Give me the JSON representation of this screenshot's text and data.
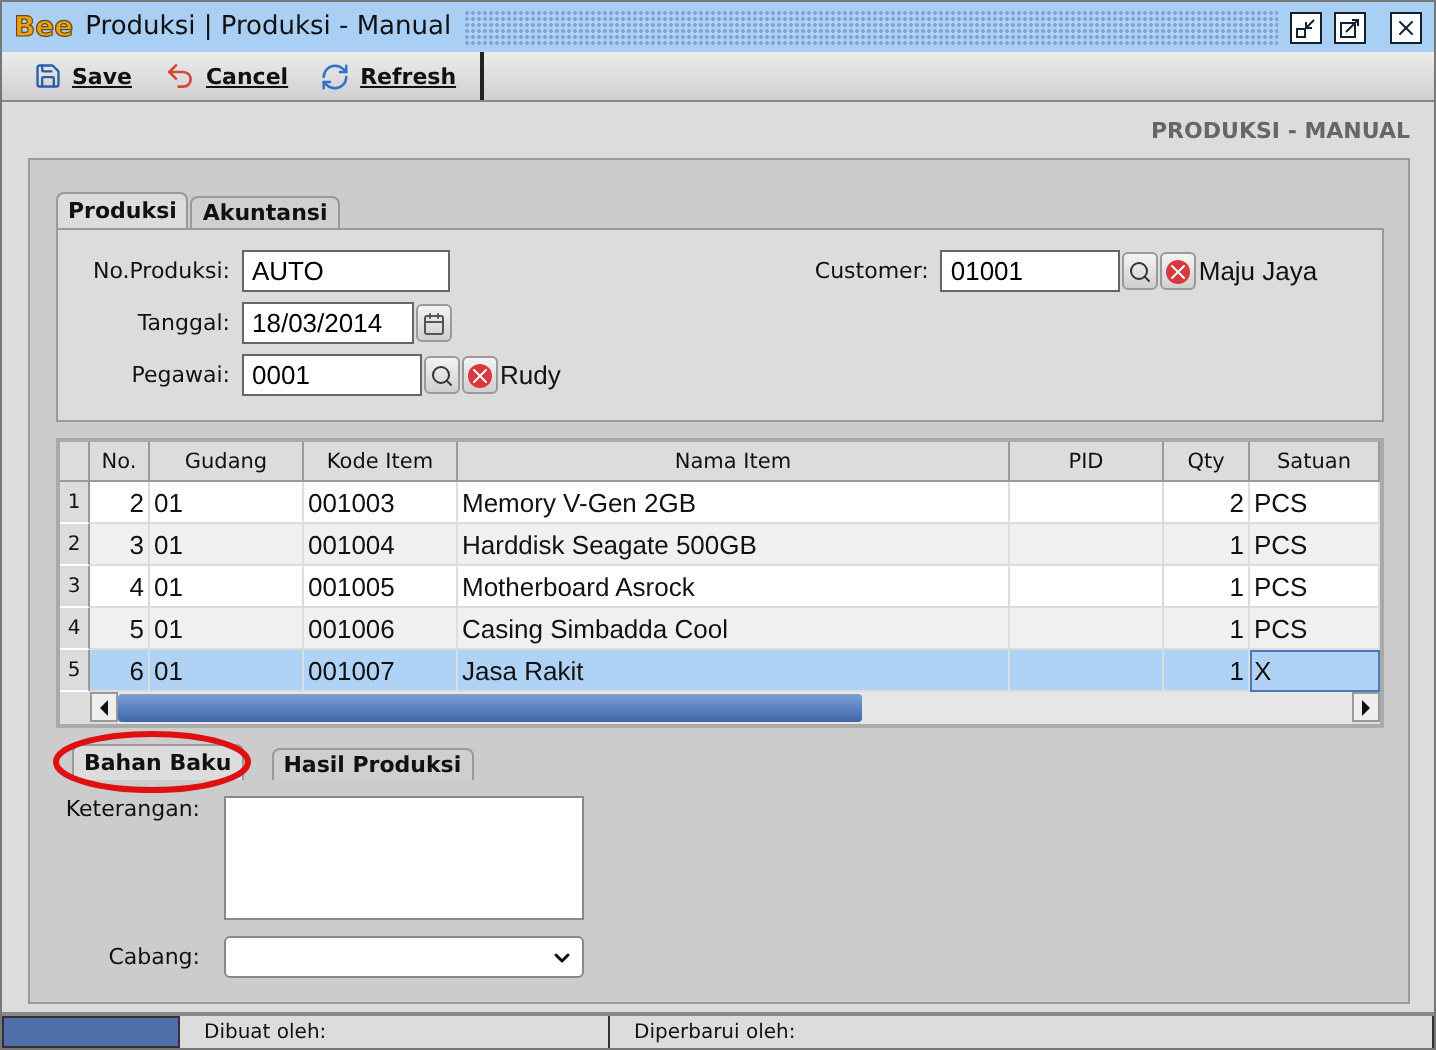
{
  "window": {
    "logo": "Bee",
    "title": "Produksi | Produksi - Manual"
  },
  "toolbar": [
    {
      "kind": "save",
      "label": "Save"
    },
    {
      "kind": "cancel",
      "label": "Cancel"
    },
    {
      "kind": "refresh",
      "label": "Refresh"
    }
  ],
  "page_heading": "PRODUKSI - MANUAL",
  "tabs": [
    {
      "label": "Produksi",
      "selected": true
    },
    {
      "label": "Akuntansi",
      "selected": false
    }
  ],
  "form": {
    "no_produksi": {
      "label": "No.Produksi:",
      "value": "AUTO"
    },
    "tanggal": {
      "label": "Tanggal:",
      "value": "18/03/2014"
    },
    "pegawai": {
      "label": "Pegawai:",
      "value": "0001",
      "name": "Rudy"
    },
    "customer": {
      "label": "Customer:",
      "value": "01001",
      "name": "Maju Jaya"
    }
  },
  "table": {
    "columns": [
      "No.",
      "Gudang",
      "Kode Item",
      "Nama Item",
      "PID",
      "Qty",
      "Satuan"
    ],
    "rows": [
      {
        "row_number": "1",
        "cells": [
          "2",
          "01",
          "001003",
          "Memory V-Gen 2GB",
          "",
          "2",
          "PCS"
        ],
        "selected": false
      },
      {
        "row_number": "2",
        "cells": [
          "3",
          "01",
          "001004",
          "Harddisk Seagate 500GB",
          "",
          "1",
          "PCS"
        ],
        "selected": false
      },
      {
        "row_number": "3",
        "cells": [
          "4",
          "01",
          "001005",
          "Motherboard Asrock",
          "",
          "1",
          "PCS"
        ],
        "selected": false
      },
      {
        "row_number": "4",
        "cells": [
          "5",
          "01",
          "001006",
          "Casing Simbadda Cool",
          "",
          "1",
          "PCS"
        ],
        "selected": false
      },
      {
        "row_number": "5",
        "cells": [
          "6",
          "01",
          "001007",
          "Jasa Rakit",
          "",
          "1",
          "X"
        ],
        "selected": true
      }
    ]
  },
  "sub_tabs": [
    {
      "label": "Bahan Baku",
      "selected": true,
      "circled": true
    },
    {
      "label": "Hasil Produksi",
      "selected": false,
      "circled": false
    }
  ],
  "keterangan": {
    "label": "Keterangan:"
  },
  "cabang": {
    "label": "Cabang:"
  },
  "status_bar": [
    "Dibuat oleh:",
    "Diperbarui oleh:"
  ]
}
